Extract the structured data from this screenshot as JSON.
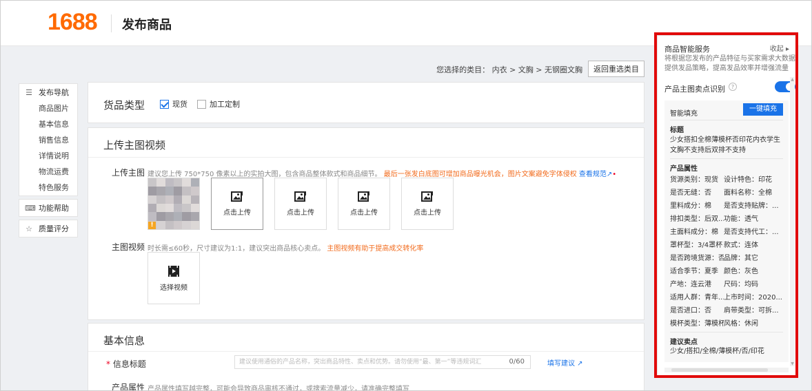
{
  "header": {
    "logo": "1688",
    "title": "发布商品"
  },
  "category": {
    "label": "您选择的类目： 内衣 > 文胸 > 无钢圈文胸",
    "reselect_button": "返回重选类目"
  },
  "left_nav": {
    "group1_title": "发布导航",
    "items": [
      "商品图片",
      "基本信息",
      "销售信息",
      "详情说明",
      "物流运费",
      "特色服务"
    ],
    "help": "功能帮助",
    "quality": "质量评分"
  },
  "goods_type": {
    "title": "货品类型",
    "options": [
      {
        "label": "现货",
        "checked": true
      },
      {
        "label": "加工定制",
        "checked": false
      }
    ]
  },
  "upload_section": {
    "title": "上传主图视频",
    "main_image_label": "上传主图",
    "main_image_hint": "建议您上传 750*750 像素以上的实拍大图，包含商品整体款式和商品细节。",
    "main_image_hint_orange": "最后一张发白底图可增加商品曝光机会，图片文案避免字体侵权",
    "main_image_hint_link": "查看规范",
    "upload_label": "点击上传",
    "video_label": "主图视频",
    "video_hint": "时长需≤60秒，尺寸建议为1:1，建议突出商品核心卖点。",
    "video_hint_orange": "主图视频有助于提高成交转化率",
    "video_button": "选择视频"
  },
  "basic_info": {
    "title": "基本信息",
    "title_field_label": "信息标题",
    "title_field_placeholder": "建议使用通俗的产品名称，突出商品特性、卖点和优势。请勿使用“最、第一”等违规词汇",
    "title_counter": "0/60",
    "fill_suggest": "填写建议",
    "attr_label": "产品属性",
    "attr_hint": "产品属性填写越完整，可能会导致商品审核不通过，或搜索流量减少，请准确完整填写"
  },
  "right_panel": {
    "title": "商品智能服务",
    "collapse": "收起",
    "desc": "将根据您发布的产品特征与买家需求大数据提供发品策略，提高发品效率并增强流量",
    "toggle_label": "产品主图卖点识别",
    "toggle_on": true,
    "smart_fill": "智能填充",
    "fill_button": "一键填充",
    "title_heading": "标题",
    "title_value": "少女搭扣全棉薄模杯否印花内衣学生文胸不支持后双排不支持",
    "attr_heading": "产品属性",
    "attrs": [
      [
        "货源类别：现货",
        "设计特色：印花"
      ],
      [
        "是否无缝：否",
        "面料名称：全棉"
      ],
      [
        "里料成分：棉",
        "是否支持贴牌：..."
      ],
      [
        "排扣类型：后双...",
        "功能：透气"
      ],
      [
        "主面料成分：棉",
        "是否支持代工：..."
      ],
      [
        "罩杯型：3/4罩杯",
        "款式：连体"
      ],
      [
        "是否跨境货源：否",
        "品牌：其它"
      ],
      [
        "适合季节：夏季",
        "颜色：灰色"
      ],
      [
        "产地：连云港",
        "尺码：均码"
      ],
      [
        "适用人群：青年...",
        "上市时间：2020..."
      ],
      [
        "是否进口：否",
        "肩带类型：可拆..."
      ],
      [
        "模杯类型：薄模杯",
        "风格：休闲"
      ]
    ],
    "selling_heading": "建议卖点",
    "selling_value": "少女/搭扣/全棉/薄模杯/否/印花"
  },
  "colors": {
    "brand": "#ff6a00",
    "accent": "#1a73e8",
    "highlight_box": "#e10a0a",
    "warning": "#f26b1d"
  }
}
